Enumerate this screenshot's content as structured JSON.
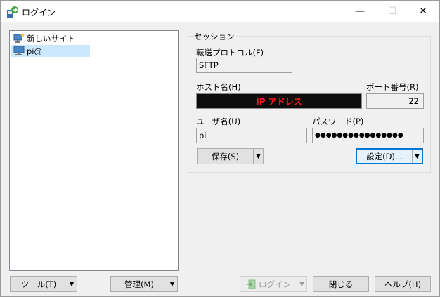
{
  "window": {
    "title": "ログイン",
    "minimize": "—",
    "maximize": "☐",
    "close": "✕"
  },
  "site_tree": {
    "items": [
      {
        "label": "新しいサイト",
        "icon": "new-site-icon"
      },
      {
        "label": "pi@",
        "icon": "computer-icon",
        "selected": true
      }
    ]
  },
  "session": {
    "group_label": "セッション",
    "protocol_label": "転送プロトコル(F)",
    "protocol_value": "SFTP",
    "host_label": "ホスト名(H)",
    "host_value": "IP アドレス",
    "port_label": "ポート番号(R)",
    "port_value": "22",
    "user_label": "ユーザ名(U)",
    "user_value": "pi",
    "password_label": "パスワード(P)",
    "password_value": "●●●●●●●●●●●●●●●●",
    "save_label": "保存(S)",
    "settings_label": "設定(D)..."
  },
  "bottom": {
    "tools_label": "ツール(T)",
    "manage_label": "管理(M)",
    "login_label": "ログイン",
    "close_label": "閉じる",
    "help_label": "ヘルプ(H)"
  },
  "colors": {
    "host_bg": "#0c0c0c",
    "host_text": "#ff1a1a",
    "selected_bg": "#cce8ff",
    "focus_border": "#0078d7"
  }
}
